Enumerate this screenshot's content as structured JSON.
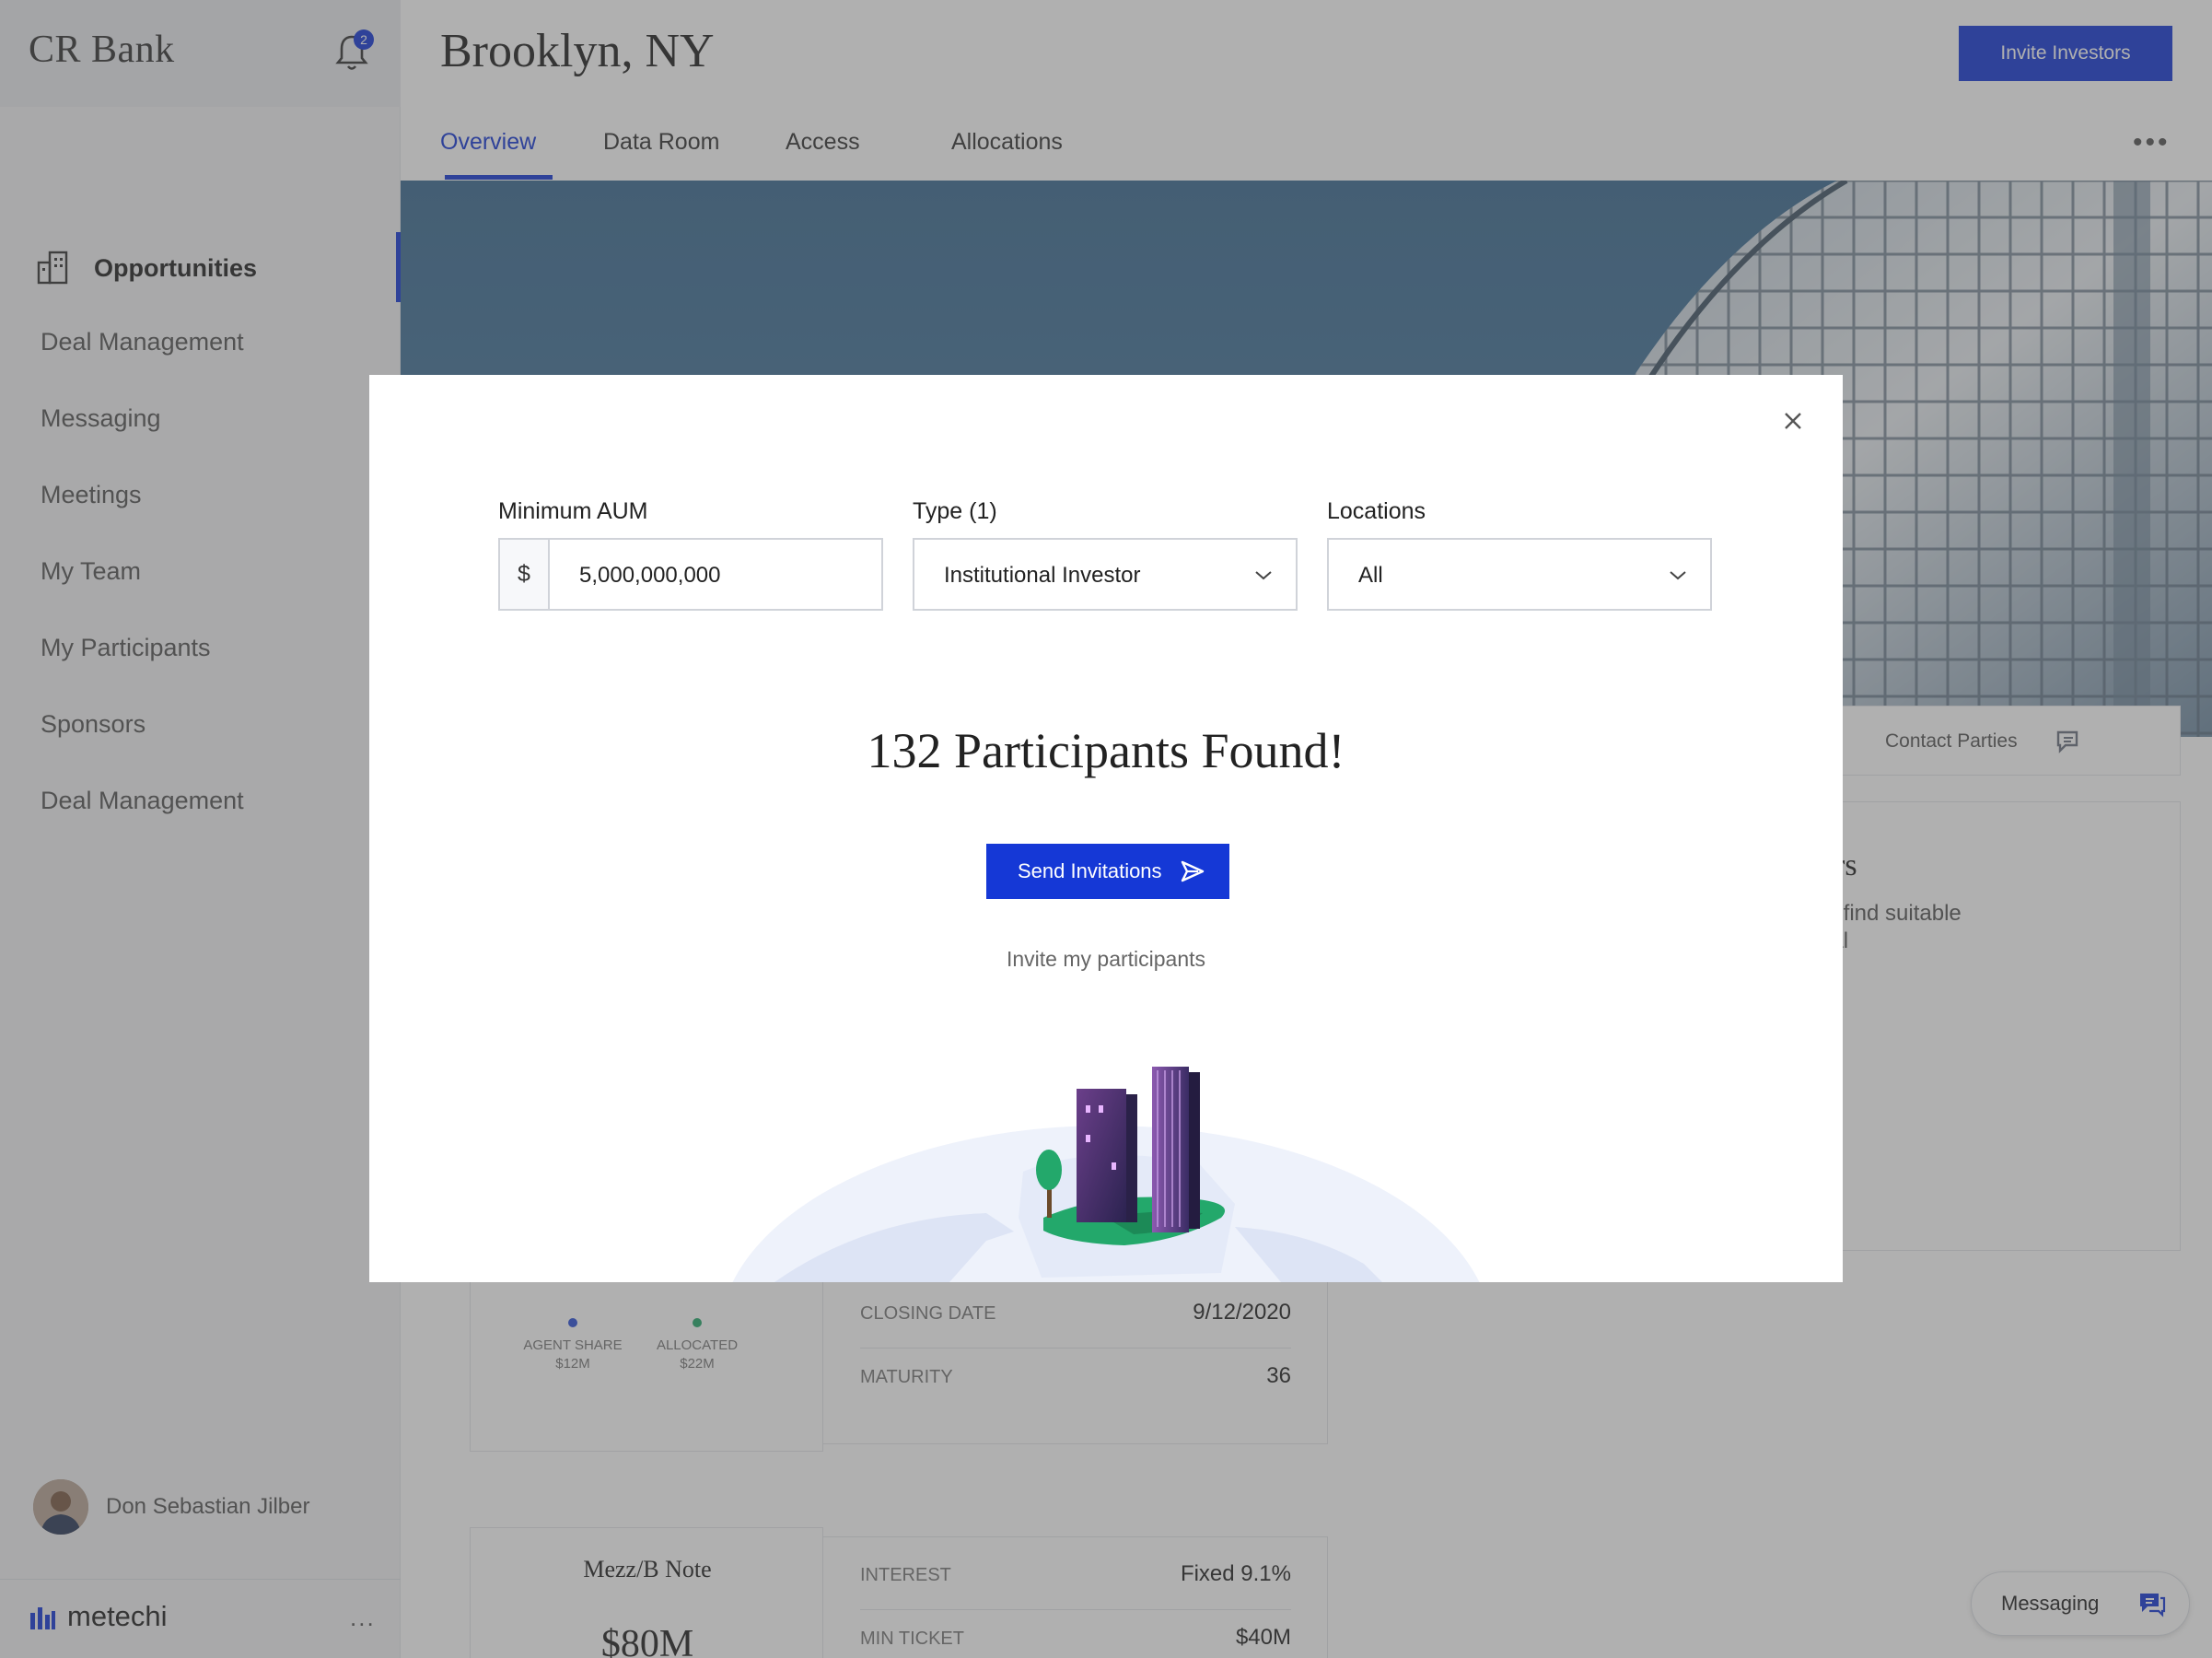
{
  "sidebar": {
    "brand": "CR Bank",
    "notification_count": "2",
    "active_item": "Opportunities",
    "items": [
      "Deal Management",
      "Messaging",
      "Meetings",
      "My Team",
      "My Participants",
      "Sponsors",
      "Deal Management"
    ],
    "user_name": "Don Sebastian Jilber",
    "footer_logo": "metechi",
    "footer_more": "..."
  },
  "header": {
    "title": "Brooklyn, NY",
    "invite_button": "Invite Investors",
    "more": "•••"
  },
  "tabs": [
    {
      "label": "Overview",
      "active": true
    },
    {
      "label": "Data Room",
      "active": false
    },
    {
      "label": "Access",
      "active": false
    },
    {
      "label": "Allocations",
      "active": false
    }
  ],
  "background_cards": {
    "contact_parties": "Contact Parties",
    "find_title": "ors",
    "find_text_1": "to find suitable",
    "find_text_2": "eal",
    "legend": [
      {
        "label": "AGENT SHARE",
        "value": "$12M",
        "color": "#2b4fd8"
      },
      {
        "label": "ALLOCATED",
        "value": "$22M",
        "color": "#23a86b"
      }
    ],
    "details": [
      {
        "key": "CLOSING DATE",
        "value": "9/12/2020"
      },
      {
        "key": "MATURITY",
        "value": "36"
      }
    ],
    "note_title": "Mezz/B Note",
    "note_amount": "$80M",
    "note_details": [
      {
        "key": "INTEREST",
        "value": "Fixed 9.1%"
      },
      {
        "key": "MIN TICKET",
        "value": "$40M"
      }
    ],
    "messaging_button": "Messaging"
  },
  "modal": {
    "min_aum_label": "Minimum AUM",
    "currency_prefix": "$",
    "min_aum_value": "5,000,000,000",
    "type_label": "Type (1)",
    "type_value": "Institutional Investor",
    "locations_label": "Locations",
    "locations_value": "All",
    "result_title": "132 Participants Found!",
    "send_button": "Send Invitations",
    "invite_link": "Invite my participants"
  },
  "colors": {
    "accent": "#1538d6",
    "green": "#23a86b",
    "overlay": "rgba(80,80,80,0.45)"
  },
  "icons": {
    "bell": "bell-icon",
    "opportunities": "buildings-icon",
    "close": "close-icon",
    "chevron": "chevron-down-icon",
    "send": "send-icon",
    "chat": "chat-icon"
  }
}
